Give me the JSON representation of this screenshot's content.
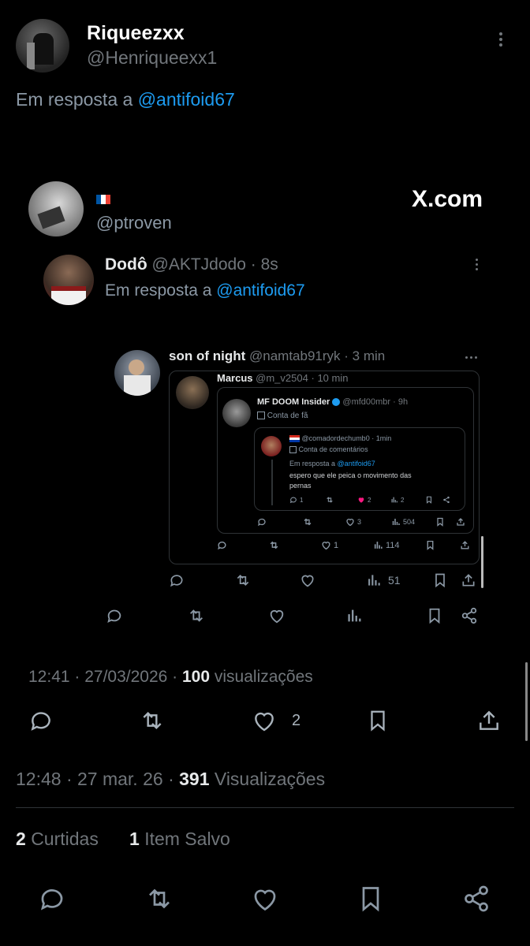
{
  "post": {
    "display_name": "Riqueezxx",
    "handle": "@Henriqueexx1",
    "reply_prefix": "Em resposta a",
    "reply_to": "@antifoid67"
  },
  "image": {
    "flag": "🇫🇷",
    "handle": "@ptroven",
    "watermark": "X.com",
    "inner": {
      "name": "Dodô",
      "handle": "@AKTJdodo",
      "sep": "·",
      "time": "8s",
      "reply_prefix": "Em resposta a",
      "reply_to": "@antifoid67"
    },
    "nested": {
      "name": "son of night",
      "handle": "@namtab91ryk",
      "time": "3 min",
      "views": "51"
    },
    "marcus": {
      "name": "Marcus",
      "handle": "@m_v2504",
      "time": "10 min",
      "likes": "1",
      "views": "114"
    },
    "mfdoom": {
      "name": "MF DOOM Insider",
      "handle": "@mfd00mbr",
      "time": "9h",
      "label": "Conta de fã",
      "likes": "3",
      "views": "504"
    },
    "comment": {
      "handle": "@comadordechumb0",
      "time": "1min",
      "label": "Conta de comentários",
      "reply_prefix": "Em resposta a",
      "reply_to": "@antifoid67",
      "text_line1": "espero que ele peica o movimento das",
      "text_line2": "pernas",
      "replies": "1",
      "likes": "2",
      "views": "2"
    },
    "footer_time": "12:41 · 27/03/2026 ·",
    "footer_views": "100",
    "footer_views_label": "visualizações",
    "footer_likes": "2"
  },
  "meta": {
    "time": "12:48 · 27 mar. 26 ·",
    "views": "391",
    "views_label": "Visualizações"
  },
  "stats": {
    "likes_count": "2",
    "likes_label": "Curtidas",
    "saved_count": "1",
    "saved_label": "Item Salvo"
  },
  "colors": {
    "accent": "#1d9bf0",
    "background": "#000000",
    "like_pink": "#f91880"
  }
}
